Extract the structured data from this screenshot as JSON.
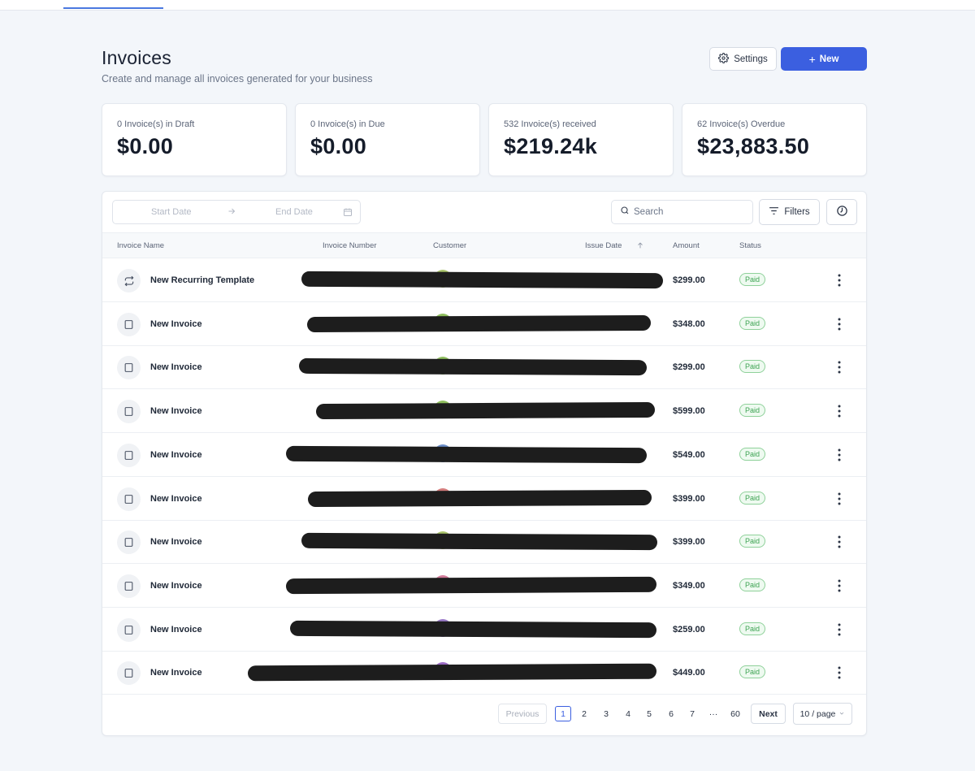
{
  "header": {
    "title": "Invoices",
    "subtitle": "Create and manage all invoices generated for your business",
    "settings_label": "Settings",
    "new_label": "New"
  },
  "stats": [
    {
      "label": "0 Invoice(s) in Draft",
      "value": "$0.00"
    },
    {
      "label": "0 Invoice(s) in Due",
      "value": "$0.00"
    },
    {
      "label": "532 Invoice(s) received",
      "value": "$219.24k"
    },
    {
      "label": "62 Invoice(s) Overdue",
      "value": "$23,883.50"
    }
  ],
  "toolbar": {
    "start_date_placeholder": "Start Date",
    "end_date_placeholder": "End Date",
    "search_placeholder": "Search",
    "filters_label": "Filters"
  },
  "table": {
    "columns": {
      "name": "Invoice Name",
      "number": "Invoice Number",
      "customer": "Customer",
      "issue_date": "Issue Date",
      "amount": "Amount",
      "status": "Status"
    },
    "rows": [
      {
        "name": "New Recurring Template",
        "amount": "$299.00",
        "status": "Paid",
        "icon": "recurring-icon",
        "avatar_color": "#a9c46a"
      },
      {
        "name": "New Invoice",
        "amount": "$348.00",
        "status": "Paid",
        "icon": "invoice-icon",
        "avatar_color": "#8fbf5e"
      },
      {
        "name": "New Invoice",
        "amount": "$299.00",
        "status": "Paid",
        "icon": "invoice-icon",
        "avatar_color": "#8fbf5e"
      },
      {
        "name": "New Invoice",
        "amount": "$599.00",
        "status": "Paid",
        "icon": "invoice-icon",
        "avatar_color": "#8fbf5e"
      },
      {
        "name": "New Invoice",
        "amount": "$549.00",
        "status": "Paid",
        "icon": "invoice-icon",
        "avatar_color": "#6b8ec9"
      },
      {
        "name": "New Invoice",
        "amount": "$399.00",
        "status": "Paid",
        "icon": "invoice-icon",
        "avatar_color": "#d27b7b"
      },
      {
        "name": "New Invoice",
        "amount": "$399.00",
        "status": "Paid",
        "icon": "invoice-icon",
        "avatar_color": "#a9c46a"
      },
      {
        "name": "New Invoice",
        "amount": "$349.00",
        "status": "Paid",
        "icon": "invoice-icon",
        "avatar_color": "#d27b9a"
      },
      {
        "name": "New Invoice",
        "amount": "$259.00",
        "status": "Paid",
        "icon": "invoice-icon",
        "avatar_color": "#9b7bc9"
      },
      {
        "name": "New Invoice",
        "amount": "$449.00",
        "status": "Paid",
        "icon": "invoice-icon",
        "avatar_color": "#9b6bc4"
      }
    ]
  },
  "pagination": {
    "previous_label": "Previous",
    "next_label": "Next",
    "pages": [
      "1",
      "2",
      "3",
      "4",
      "5",
      "6",
      "7",
      "···",
      "60"
    ],
    "current_page": "1",
    "page_size_label": "10 / page"
  },
  "colors": {
    "accent": "#3b5fe0",
    "paid_badge": "#3da352",
    "background": "#f3f6fa"
  }
}
